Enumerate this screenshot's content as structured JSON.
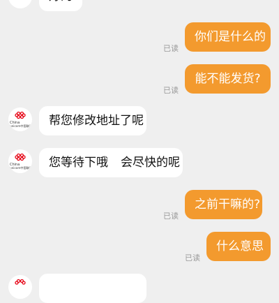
{
  "colors": {
    "background": "#efefef",
    "incoming_bubble": "#ffffff",
    "outgoing_bubble": "#f39a2e",
    "read_receipt": "#9a9a9a",
    "avatar_logo": "#e60012"
  },
  "contact": {
    "avatar_icon": "china-unicom-logo-icon",
    "avatar_logo_text": "China unicom中国联通"
  },
  "messages": [
    {
      "direction": "in",
      "text": "好的"
    },
    {
      "direction": "out",
      "text": "你们是什么的",
      "status": "已读"
    },
    {
      "direction": "out",
      "text": "能不能发货?",
      "status": "已读"
    },
    {
      "direction": "in",
      "text": "帮您修改地址了呢"
    },
    {
      "direction": "in",
      "text_parts": [
        "您等待下哦",
        "会尽快的呢"
      ]
    },
    {
      "direction": "out",
      "text": "之前干嘛的?",
      "status": "已读"
    },
    {
      "direction": "out",
      "text": "什么意思",
      "status": "已读"
    },
    {
      "direction": "in",
      "text": ""
    }
  ]
}
